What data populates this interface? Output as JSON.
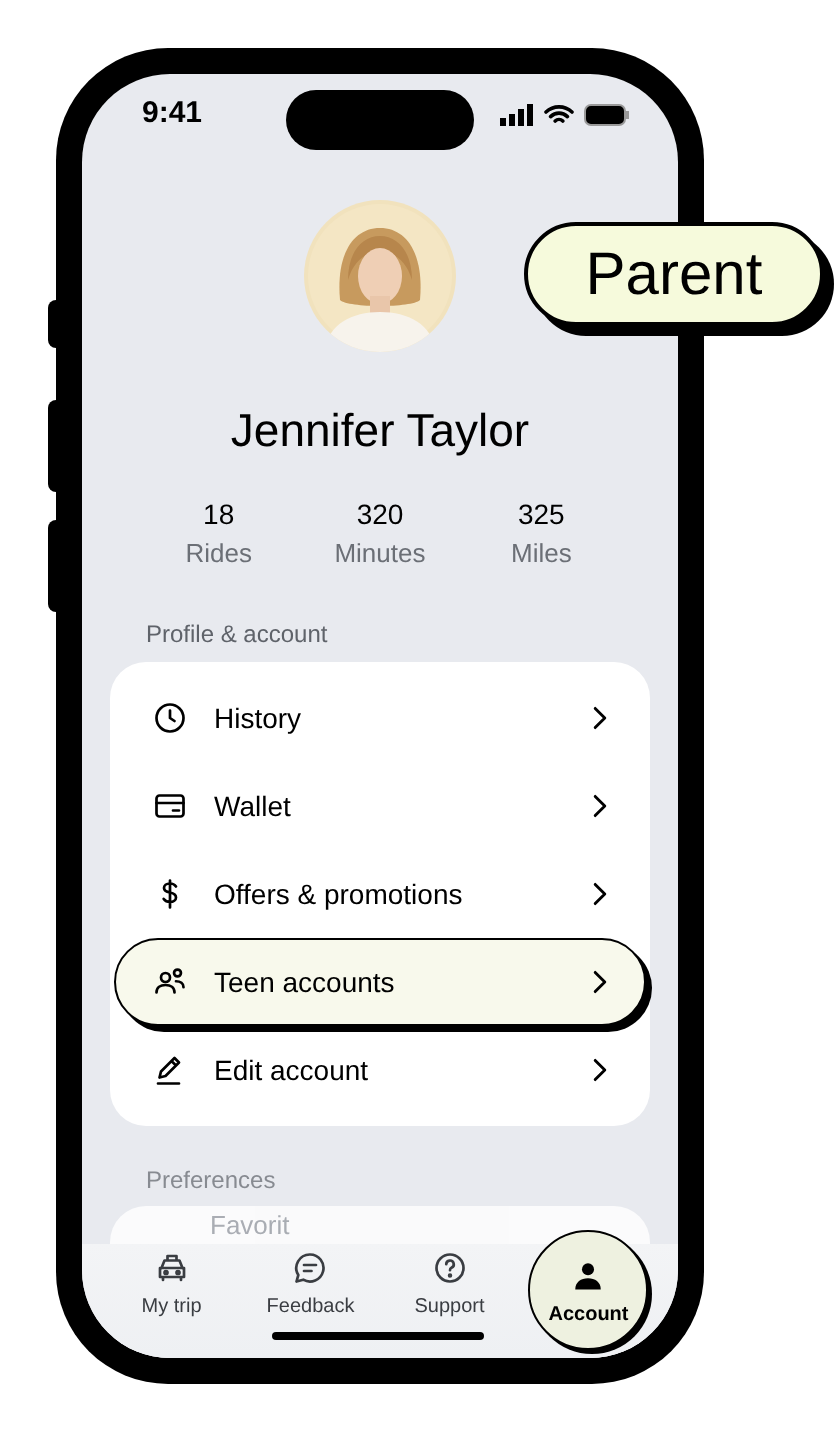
{
  "status_bar": {
    "time": "9:41"
  },
  "badge": {
    "label": "Parent"
  },
  "profile": {
    "name": "Jennifer Taylor",
    "stats": [
      {
        "value": "18",
        "label": "Rides"
      },
      {
        "value": "320",
        "label": "Minutes"
      },
      {
        "value": "325",
        "label": "Miles"
      }
    ]
  },
  "sections": [
    {
      "title": "Profile & account",
      "items": [
        {
          "label": "History",
          "kind": "clock",
          "selected": false
        },
        {
          "label": "Wallet",
          "kind": "card",
          "selected": false
        },
        {
          "label": "Offers & promotions",
          "kind": "dollar",
          "selected": false
        },
        {
          "label": "Teen accounts",
          "kind": "people",
          "selected": true
        },
        {
          "label": "Edit account",
          "kind": "pencil",
          "selected": false
        }
      ]
    },
    {
      "title": "Preferences",
      "items": [
        {
          "label": "Favorit",
          "selected": false
        }
      ]
    }
  ],
  "nav": [
    {
      "label": "My trip",
      "kind": "car",
      "selected": false
    },
    {
      "label": "Feedback",
      "kind": "chat",
      "selected": false
    },
    {
      "label": "Support",
      "kind": "help",
      "selected": false
    },
    {
      "label": "Account",
      "kind": "person",
      "selected": true
    }
  ]
}
